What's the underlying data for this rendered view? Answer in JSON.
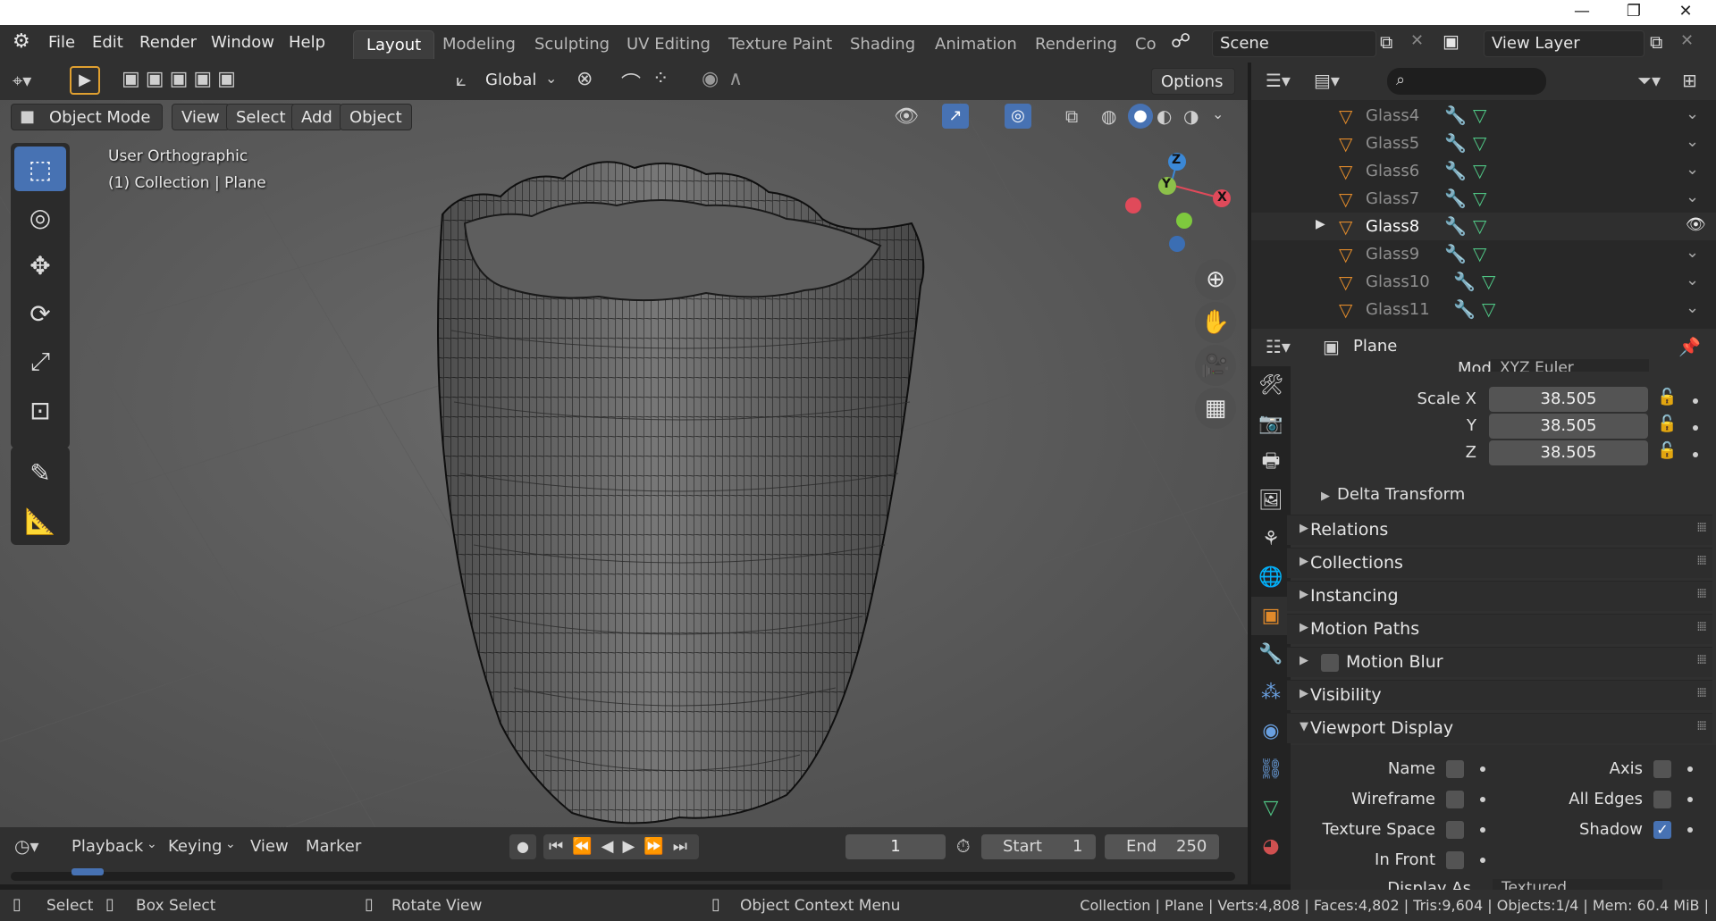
{
  "window_controls": {
    "minimize": "—",
    "maximize": "❐",
    "close": "✕"
  },
  "menu": {
    "items": [
      "File",
      "Edit",
      "Render",
      "Window",
      "Help"
    ]
  },
  "workspaces": {
    "tabs": [
      "Layout",
      "Modeling",
      "Sculpting",
      "UV Editing",
      "Texture Paint",
      "Shading",
      "Animation",
      "Rendering",
      "Co"
    ],
    "active": "Layout"
  },
  "scene": {
    "name": "Scene",
    "view_layer": "View Layer"
  },
  "viewport_header": {
    "transform_orientation": "Global",
    "options_label": "Options",
    "mode": "Object Mode",
    "view": "View",
    "select": "Select",
    "add": "Add",
    "object": "Object"
  },
  "viewport_overlay": {
    "projection": "User Orthographic",
    "collection_info": "(1) Collection | Plane"
  },
  "gizmo": {
    "z": "Z",
    "y": "Y",
    "x": "X"
  },
  "outliner": {
    "rows": [
      {
        "name": "Glass4",
        "active": false
      },
      {
        "name": "Glass5",
        "active": false
      },
      {
        "name": "Glass6",
        "active": false
      },
      {
        "name": "Glass7",
        "active": false
      },
      {
        "name": "Glass8",
        "active": true
      },
      {
        "name": "Glass9",
        "active": false
      },
      {
        "name": "Glass10",
        "active": false
      },
      {
        "name": "Glass11",
        "active": false
      }
    ]
  },
  "properties": {
    "object_name": "Plane",
    "rotation_mode_label": "Mode",
    "rotation_mode_value": "XYZ Euler",
    "scale": {
      "x_label": "Scale X",
      "y_label": "Y",
      "z_label": "Z",
      "x": "38.505",
      "y": "38.505",
      "z": "38.505"
    },
    "delta_transform": "Delta Transform",
    "panels": [
      "Relations",
      "Collections",
      "Instancing",
      "Motion Paths",
      "Motion Blur",
      "Visibility",
      "Viewport Display"
    ],
    "viewport_display": {
      "name": "Name",
      "wireframe": "Wireframe",
      "texture_space": "Texture Space",
      "in_front": "In Front",
      "axis": "Axis",
      "all_edges": "All Edges",
      "shadow": "Shadow",
      "shadow_checked": true,
      "display_as_label": "Display As",
      "display_as_value": "Textured"
    }
  },
  "timeline": {
    "playback": "Playback",
    "keying": "Keying",
    "view": "View",
    "marker": "Marker",
    "current_frame": "1",
    "start_label": "Start",
    "start": "1",
    "end_label": "End",
    "end": "250"
  },
  "statusbar": {
    "select": "Select",
    "box_select": "Box Select",
    "rotate_view": "Rotate View",
    "context_menu": "Object Context Menu",
    "stats": "Collection | Plane | Verts:4,808 | Faces:4,802 | Tris:9,604 | Objects:1/4 | Mem: 60.4 MiB |"
  },
  "colors": {
    "accent": "#4772b3",
    "object_orange": "#e08a2b",
    "mesh_green": "#4fc484"
  }
}
